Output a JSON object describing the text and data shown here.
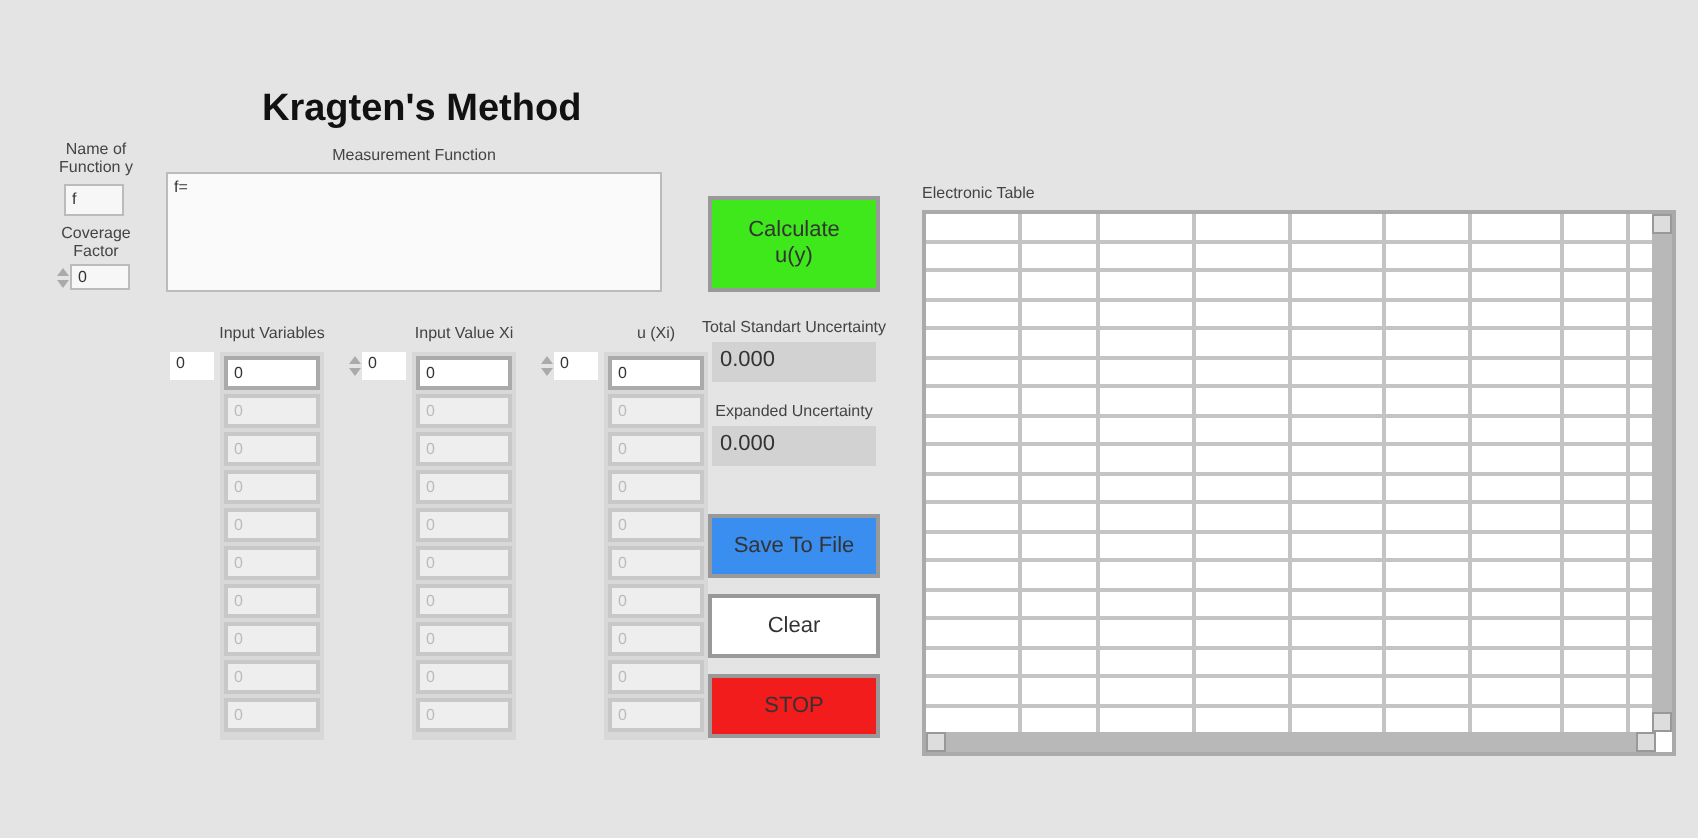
{
  "title": "Kragten's Method",
  "name_of_function": {
    "label": "Name of Function y",
    "value": "f"
  },
  "coverage_factor": {
    "label": "Coverage Factor",
    "value": "0"
  },
  "measurement_function": {
    "label": "Measurement Function",
    "value": "f="
  },
  "arrays": [
    {
      "label": "Input Variables",
      "index": "0",
      "spinner": false,
      "elements": [
        {
          "value": "0",
          "disabled": false
        },
        {
          "value": "0",
          "disabled": true
        },
        {
          "value": "0",
          "disabled": true
        },
        {
          "value": "0",
          "disabled": true
        },
        {
          "value": "0",
          "disabled": true
        },
        {
          "value": "0",
          "disabled": true
        },
        {
          "value": "0",
          "disabled": true
        },
        {
          "value": "0",
          "disabled": true
        },
        {
          "value": "0",
          "disabled": true
        },
        {
          "value": "0",
          "disabled": true
        }
      ]
    },
    {
      "label": "Input Value Xi",
      "index": "0",
      "spinner": true,
      "elements": [
        {
          "value": "0",
          "disabled": false
        },
        {
          "value": "0",
          "disabled": true
        },
        {
          "value": "0",
          "disabled": true
        },
        {
          "value": "0",
          "disabled": true
        },
        {
          "value": "0",
          "disabled": true
        },
        {
          "value": "0",
          "disabled": true
        },
        {
          "value": "0",
          "disabled": true
        },
        {
          "value": "0",
          "disabled": true
        },
        {
          "value": "0",
          "disabled": true
        },
        {
          "value": "0",
          "disabled": true
        }
      ]
    },
    {
      "label": "u (Xi)",
      "index": "0",
      "spinner": true,
      "elements": [
        {
          "value": "0",
          "disabled": false
        },
        {
          "value": "0",
          "disabled": true
        },
        {
          "value": "0",
          "disabled": true
        },
        {
          "value": "0",
          "disabled": true
        },
        {
          "value": "0",
          "disabled": true
        },
        {
          "value": "0",
          "disabled": true
        },
        {
          "value": "0",
          "disabled": true
        },
        {
          "value": "0",
          "disabled": true
        },
        {
          "value": "0",
          "disabled": true
        },
        {
          "value": "0",
          "disabled": true
        }
      ]
    }
  ],
  "calculate_button": {
    "label": "Calculate u(y)",
    "color": "#3ee81a"
  },
  "indicators": [
    {
      "label": "Total Standart Uncertainty",
      "value": "0.000"
    },
    {
      "label": "Expanded Uncertainty",
      "value": "0.000"
    }
  ],
  "buttons": [
    {
      "label": "Save To File",
      "color": "#3a8ef0"
    },
    {
      "label": "Clear",
      "color": "#ffffff"
    },
    {
      "label": "STOP",
      "color": "#f21c1c"
    }
  ],
  "table": {
    "label": "Electronic Table"
  }
}
